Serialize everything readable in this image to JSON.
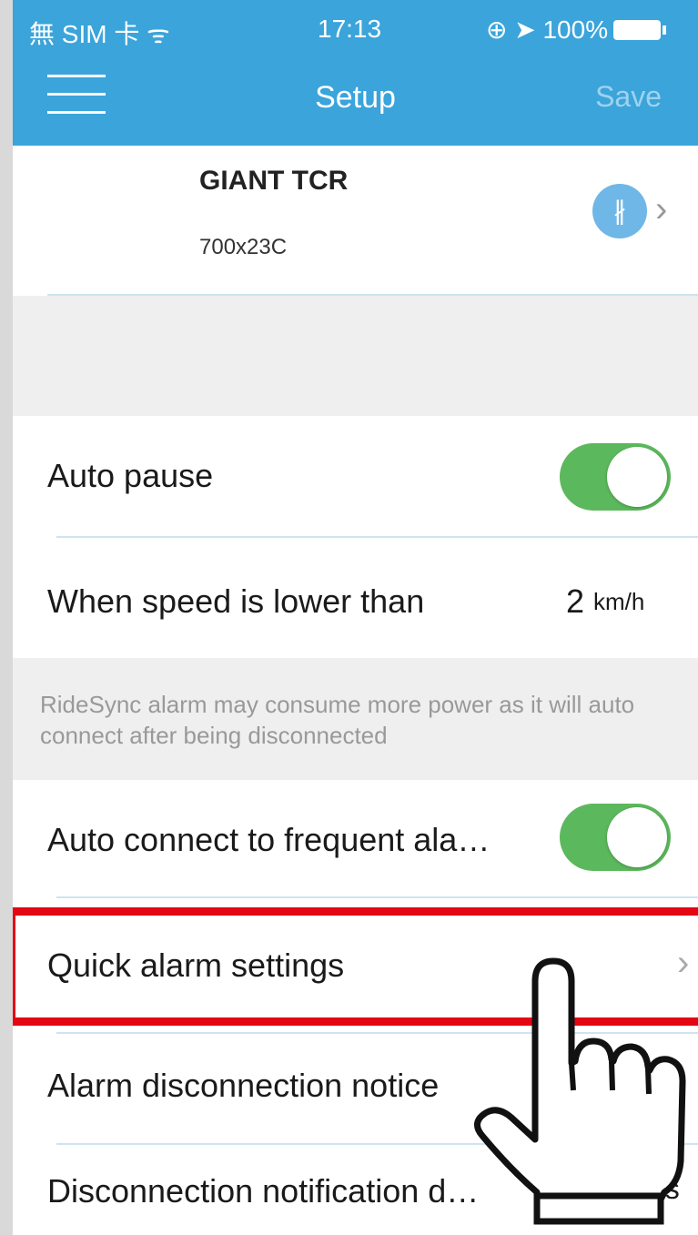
{
  "status_bar": {
    "carrier": "無 SIM 卡 ᯤ",
    "time": "17:13",
    "right": "⊕ ➤ 100%",
    "battery_percent": 100
  },
  "nav": {
    "title": "Setup",
    "save_label": "Save",
    "menu_icon": "hamburger-menu-icon"
  },
  "bike": {
    "name": "GIANT TCR",
    "tire": "700x23C",
    "bluetooth_icon": "bluetooth-icon",
    "bluetooth_glyph": "∦",
    "chevron": "›"
  },
  "auto_pause": {
    "label": "Auto pause",
    "on": true
  },
  "speed": {
    "label": "When speed is lower than",
    "value": "2",
    "unit": "km/h"
  },
  "notice": "RideSync alarm may consume more power as it will auto connect after being disconnected",
  "auto_connect": {
    "label": "Auto connect to frequent ala…",
    "on": true
  },
  "quick_alarm": {
    "label": "Quick alarm settings",
    "chevron": "›"
  },
  "alarm_disconnection": {
    "label": "Alarm disconnection notice"
  },
  "disconnection_delay": {
    "label": "Disconnection notification d…",
    "value": "5 s"
  },
  "colors": {
    "nav_bar": "#3aa4db",
    "toggle_on": "#5cb85c",
    "highlight": "#e30613"
  }
}
